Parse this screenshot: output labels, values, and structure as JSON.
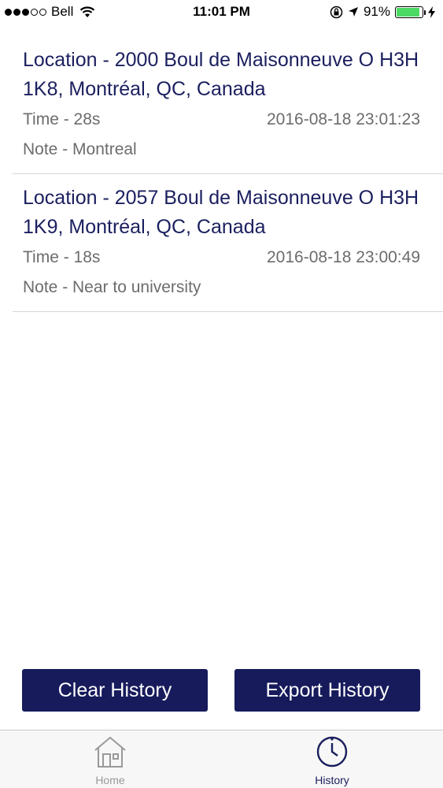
{
  "status_bar": {
    "carrier": "Bell",
    "time": "11:01 PM",
    "battery": "91%",
    "battery_level": 0.91,
    "signal_bars_filled": 3,
    "signal_bars_total": 5
  },
  "history": [
    {
      "location": "Location - 2000 Boul de Maisonneuve O H3H 1K8, Montréal, QC, Canada",
      "time": "Time - 28s",
      "timestamp": "2016-08-18 23:01:23",
      "note": "Note - Montreal"
    },
    {
      "location": "Location - 2057 Boul de Maisonneuve O H3H 1K9, Montréal, QC, Canada",
      "time": "Time - 18s",
      "timestamp": "2016-08-18 23:00:49",
      "note": "Note - Near to university"
    }
  ],
  "actions": {
    "clear_label": "Clear History",
    "export_label": "Export History"
  },
  "tabs": {
    "home_label": "Home",
    "history_label": "History",
    "active": "history"
  },
  "colors": {
    "primary": "#171b5c",
    "text_primary": "#1b1f5e",
    "text_secondary": "#6c6c6c",
    "battery": "#4cd964",
    "tab_inactive": "#999999"
  }
}
